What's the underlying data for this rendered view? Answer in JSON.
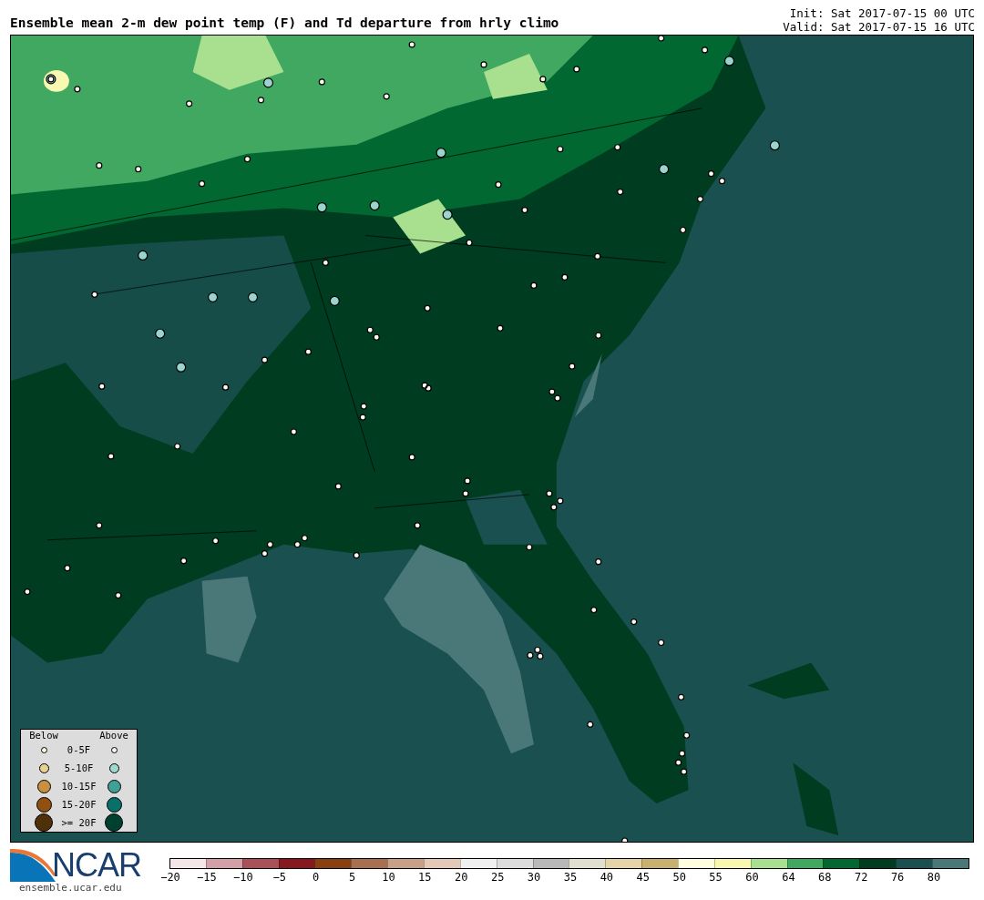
{
  "header": {
    "title": "Ensemble mean 2-m dew point temp (F) and Td departure from hrly climo",
    "init": "Init: Sat 2017-07-15 00 UTC",
    "valid": "Valid: Sat 2017-07-15 16 UTC"
  },
  "legend": {
    "below_heading": "Below",
    "above_heading": "Above",
    "rows": [
      {
        "label": "0-5F",
        "below": {
          "color": "#fff8e0"
        },
        "above": {
          "color": "#f0f8f8"
        }
      },
      {
        "label": "5-10F",
        "below": {
          "color": "#e8d090"
        },
        "above": {
          "color": "#a0d8d0"
        }
      },
      {
        "label": "10-15F",
        "below": {
          "color": "#c89040"
        },
        "above": {
          "color": "#40a098"
        }
      },
      {
        "label": "15-20F",
        "below": {
          "color": "#905010"
        },
        "above": {
          "color": "#087068"
        }
      },
      {
        "label": ">= 20F",
        "below": {
          "color": "#503008"
        },
        "above": {
          "color": "#004030"
        }
      }
    ]
  },
  "colorbar": {
    "bins": [
      {
        "color": "#f5e6ea"
      },
      {
        "color": "#d4a0a8"
      },
      {
        "color": "#aa5058"
      },
      {
        "color": "#881820"
      },
      {
        "color": "#884010"
      },
      {
        "color": "#a87050"
      },
      {
        "color": "#c8a088"
      },
      {
        "color": "#e4c8b8"
      },
      {
        "color": "#f0f0f0"
      },
      {
        "color": "#dcdcdc"
      },
      {
        "color": "#b8b8b8"
      },
      {
        "color": "#e0e0d0"
      },
      {
        "color": "#e4d4a8"
      },
      {
        "color": "#c8b070"
      },
      {
        "color": "#ffffe0"
      },
      {
        "color": "#f8f8b0"
      },
      {
        "color": "#a8e090"
      },
      {
        "color": "#40a860"
      },
      {
        "color": "#006830"
      },
      {
        "color": "#003c20"
      },
      {
        "color": "#1a5050"
      },
      {
        "color": "#4a7878"
      }
    ],
    "ticks": [
      "−20",
      "−15",
      "−10",
      "−5",
      "0",
      "5",
      "10",
      "15",
      "20",
      "25",
      "30",
      "35",
      "40",
      "45",
      "50",
      "55",
      "60",
      "64",
      "68",
      "72",
      "76",
      "80"
    ]
  },
  "footer": {
    "logo": "NCAR",
    "url": "ensemble.ucar.edu"
  }
}
